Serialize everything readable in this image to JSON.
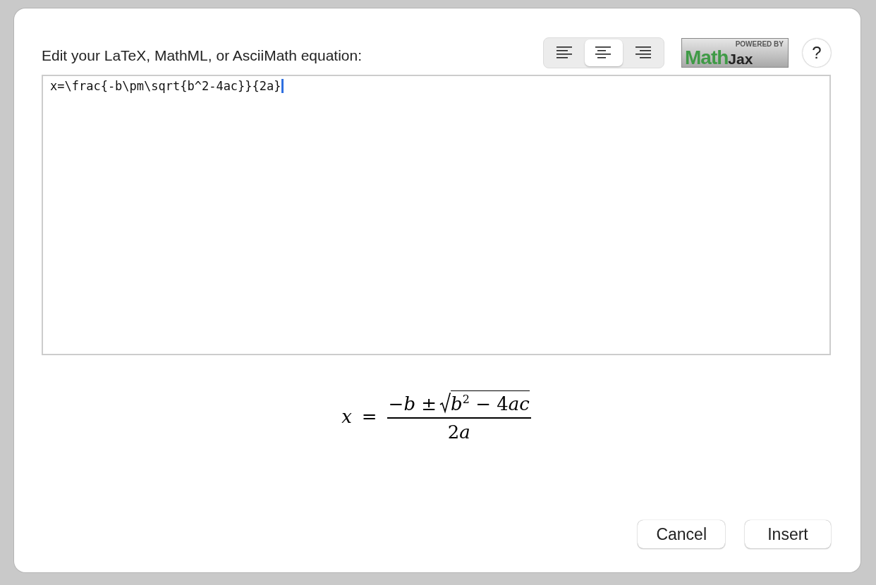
{
  "dialog": {
    "prompt": "Edit your LaTeX, MathML, or AsciiMath equation:",
    "alignment": [
      {
        "kind": "left",
        "selected": false
      },
      {
        "kind": "center",
        "selected": true
      },
      {
        "kind": "right",
        "selected": false
      }
    ],
    "logo": {
      "tagline": "POWERED BY",
      "name_1": "Math",
      "name_2": "Jax"
    },
    "help": "?",
    "equation_source": "x=\\frac{-b\\pm\\sqrt{b^2-4ac}}{2a}",
    "preview": {
      "lhs": [
        {
          "kind": "italic",
          "text": "x"
        }
      ],
      "relation": "=",
      "numerator": [
        {
          "kind": "upright",
          "text": "−"
        },
        {
          "kind": "italic",
          "text": "b"
        },
        {
          "kind": "upright",
          "text": " ±"
        }
      ],
      "radicand": [
        {
          "kind": "italic",
          "text": "b"
        },
        {
          "kind": "sup",
          "text": "2"
        },
        {
          "kind": "upright",
          "text": " − 4"
        },
        {
          "kind": "italic",
          "text": "ac"
        }
      ],
      "denominator": [
        {
          "kind": "upright",
          "text": "2"
        },
        {
          "kind": "italic",
          "text": "a"
        }
      ]
    },
    "buttons": [
      "Cancel",
      "Insert"
    ]
  }
}
